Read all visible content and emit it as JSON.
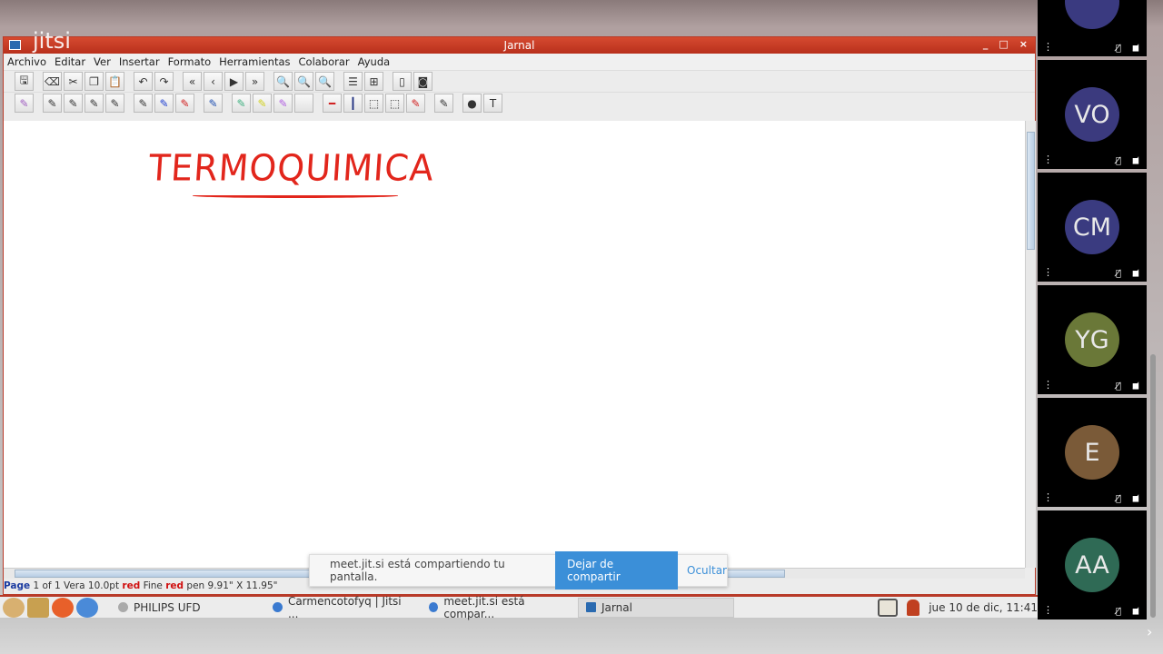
{
  "window": {
    "title": "Jarnal",
    "logo": "jitsi",
    "controls": [
      "_",
      "□",
      "×"
    ]
  },
  "menu": [
    "Archivo",
    "Editar",
    "Ver",
    "Insertar",
    "Formato",
    "Herramientas",
    "Colaborar",
    "Ayuda"
  ],
  "toolbar1": [
    "save-icon",
    "|",
    "eraser-icon",
    "cut-icon",
    "copy-icon",
    "paste-icon",
    "|",
    "undo-icon",
    "redo-icon",
    "|",
    "first-page-icon",
    "prev-page-icon",
    "next-page-icon",
    "last-page-icon",
    "|",
    "zoom-icon",
    "zoom-in-icon",
    "zoom-out-icon",
    "|",
    "single-page-icon",
    "multi-page-icon",
    "|",
    "new-page-icon",
    "background-icon"
  ],
  "toolbar2": [
    "pen-icon",
    "|",
    "pen-thin-icon",
    "pen-medium-icon",
    "pen-thick-icon",
    "pen-heavy-icon",
    "|",
    "pen-black-icon",
    "pen-blue-icon",
    "pen-red-icon",
    "|",
    "pen-color-icon",
    "|",
    "highlighter-green-icon",
    "highlighter-yellow-icon",
    "highlighter-purple-icon",
    "white-icon",
    "|",
    "horizontal-line-icon",
    "vertical-line-icon",
    "select-icon",
    "select-region-icon",
    "pointer-pen-icon",
    "|",
    "eraser-disabled-icon",
    "|",
    "image-icon",
    "text-icon"
  ],
  "canvas": {
    "handwriting": "TERMOQUIMICA"
  },
  "status": {
    "page": "Page",
    "page_info": "1 of 1 Vera 10.0pt",
    "color1": "red",
    "width": "Fine",
    "color2": "red",
    "tool": "pen  9.91\" X 11.95\""
  },
  "share_toast": {
    "message": "meet.jit.si está compartiendo tu pantalla.",
    "stop": "Dejar de compartir",
    "hide": "Ocultar"
  },
  "taskbar": {
    "tasks": [
      "PHILIPS UFD",
      "Carmencotofyq | Jitsi ...",
      "meet.jit.si está compar...",
      "Jarnal"
    ],
    "clock": "jue 10 de dic, 11:41"
  },
  "participants": [
    {
      "initials": "",
      "color": "#3a3a80"
    },
    {
      "initials": "VO",
      "color": "#3b3a7e"
    },
    {
      "initials": "CM",
      "color": "#3a3b80"
    },
    {
      "initials": "YG",
      "color": "#6a7838"
    },
    {
      "initials": "E",
      "color": "#7a5a38"
    },
    {
      "initials": "AA",
      "color": "#2f6a55"
    }
  ]
}
